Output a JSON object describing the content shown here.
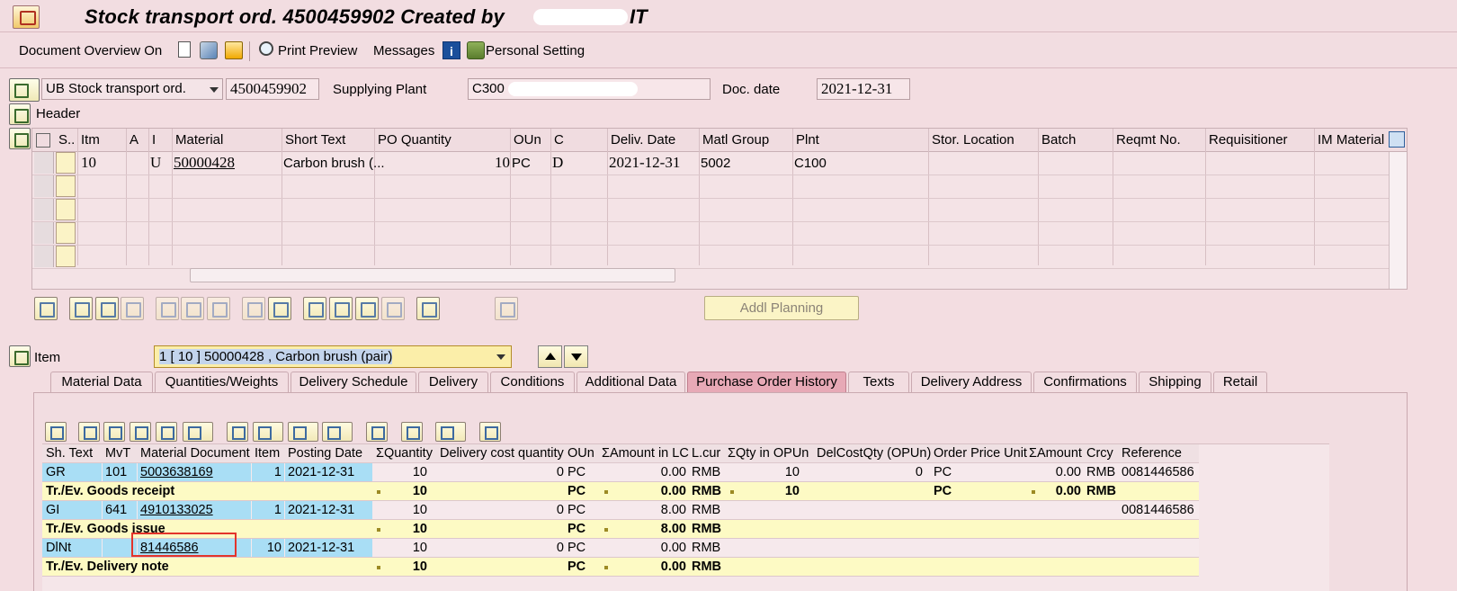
{
  "window": {
    "title": "Stock transport ord. 4500459902 Created by",
    "title_suffix": "IT"
  },
  "toolbar": {
    "document_overview": "Document Overview On",
    "print_preview": "Print Preview",
    "messages": "Messages",
    "personal_setting": "Personal Setting"
  },
  "header_fields": {
    "doc_type": "UB Stock transport ord.",
    "po_number": "4500459902",
    "supplying_plant_label": "Supplying Plant",
    "supplying_plant": "C300",
    "doc_date_label": "Doc. date",
    "doc_date": "2021-12-31",
    "header_label": "Header"
  },
  "item_table": {
    "columns": [
      "S..",
      "Itm",
      "A",
      "I",
      "Material",
      "Short Text",
      "PO Quantity",
      "OUn",
      "C",
      "Deliv. Date",
      "Matl Group",
      "Plnt",
      "Stor. Location",
      "Batch",
      "Reqmt No.",
      "Requisitioner",
      "IM Material"
    ],
    "rows": [
      {
        "itm": "10",
        "a": "",
        "i": "U",
        "material": "50000428",
        "short_text": "Carbon brush (...",
        "po_qty": "10",
        "oun": "PC",
        "c": "D",
        "deliv_date": "2021-12-31",
        "matl_group": "5002",
        "plnt": "C100"
      }
    ]
  },
  "buttons": {
    "addl_planning": "Addl Planning"
  },
  "item_nav": {
    "label": "Item",
    "selected": "1 [ 10 ] 50000428 , Carbon brush (pair)"
  },
  "tabs": [
    "Material Data",
    "Quantities/Weights",
    "Delivery Schedule",
    "Delivery",
    "Conditions",
    "Additional Data",
    "Purchase Order History",
    "Texts",
    "Delivery Address",
    "Confirmations",
    "Shipping",
    "Retail"
  ],
  "history": {
    "columns": [
      "Sh. Text",
      "MvT",
      "Material Document",
      "Item",
      "Posting Date",
      "ΣQuantity",
      "Delivery cost quantity",
      "OUn",
      "ΣAmount in LC",
      "L.cur",
      "ΣQty in OPUn",
      "DelCostQty (OPUn)",
      "Order Price Unit",
      "ΣAmount",
      "Crcy",
      "Reference"
    ],
    "rows": [
      {
        "kind": "data",
        "sh_text": "GR",
        "mvt": "101",
        "mat_doc": "5003638169",
        "item": "1",
        "posting_date": "2021-12-31",
        "qty": "10",
        "del_cost_qty": "0",
        "oun": "PC",
        "amount_lc": "0.00",
        "lcur": "RMB",
        "qty_opun": "10",
        "delcost_opun": "0",
        "order_price_unit": "PC",
        "amount": "0.00",
        "crcy": "RMB",
        "reference": "0081446586"
      },
      {
        "kind": "sum",
        "sh_text": "Tr./Ev. Goods receipt",
        "qty": "10",
        "oun": "PC",
        "amount_lc": "0.00",
        "lcur": "RMB",
        "qty_opun": "10",
        "order_price_unit": "PC",
        "amount": "0.00",
        "crcy": "RMB"
      },
      {
        "kind": "data",
        "sh_text": "GI",
        "mvt": "641",
        "mat_doc": "4910133025",
        "item": "1",
        "posting_date": "2021-12-31",
        "qty": "10",
        "del_cost_qty": "0",
        "oun": "PC",
        "amount_lc": "8.00",
        "lcur": "RMB",
        "reference": "0081446586"
      },
      {
        "kind": "sum",
        "sh_text": "Tr./Ev. Goods issue",
        "qty": "10",
        "oun": "PC",
        "amount_lc": "8.00",
        "lcur": "RMB"
      },
      {
        "kind": "data",
        "sh_text": "DlNt",
        "mvt": "",
        "mat_doc": "81446586",
        "item": "10",
        "posting_date": "2021-12-31",
        "qty": "10",
        "del_cost_qty": "0",
        "oun": "PC",
        "amount_lc": "0.00",
        "lcur": "RMB"
      },
      {
        "kind": "sum",
        "sh_text": "Tr./Ev. Delivery note",
        "qty": "10",
        "oun": "PC",
        "amount_lc": "0.00",
        "lcur": "RMB"
      }
    ]
  }
}
